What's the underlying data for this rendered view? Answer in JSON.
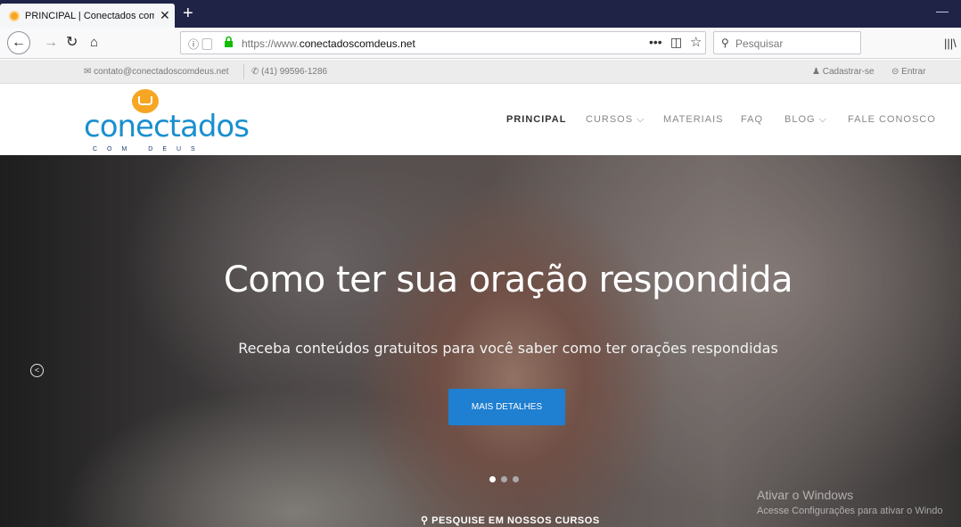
{
  "browser": {
    "tab_title": "PRINCIPAL | Conectados com D",
    "tab_close": "✕",
    "new_tab": "+",
    "url_prefix": "https://www.",
    "url_domain": "conectadoscomdeus.net",
    "search_placeholder": "Pesquisar",
    "page_actions": "•••"
  },
  "topbar": {
    "email": "contato@conectadoscomdeus.net",
    "phone": "(41) 99596-1286",
    "signup": "Cadastrar-se",
    "login": "Entrar"
  },
  "logo": {
    "word": "conectados",
    "sub": "COM DEUS"
  },
  "menu": {
    "items": [
      {
        "label": "PRINCIPAL",
        "active": true
      },
      {
        "label": "CURSOS ⌵"
      },
      {
        "label": "MATERIAIS"
      },
      {
        "label": "FAQ"
      },
      {
        "label": "BLOG ⌵"
      },
      {
        "label": "FALE CONOSCO"
      }
    ]
  },
  "hero": {
    "title": "Como ter sua oração respondida",
    "subtitle": "Receba conteúdos gratuitos para você saber como ter orações respondidas",
    "button": "MAIS DETALHES",
    "search_strip": "PESQUISE EM NOSSOS CURSOS"
  },
  "watermark": {
    "line1": "Ativar o Windows",
    "line2": "Acesse Configurações para ativar o Windo"
  },
  "colors": {
    "accent": "#1f7fd0",
    "logo_blue": "#1a8fcf",
    "logo_orange": "#f6a623",
    "tabbar": "#1f2447"
  }
}
